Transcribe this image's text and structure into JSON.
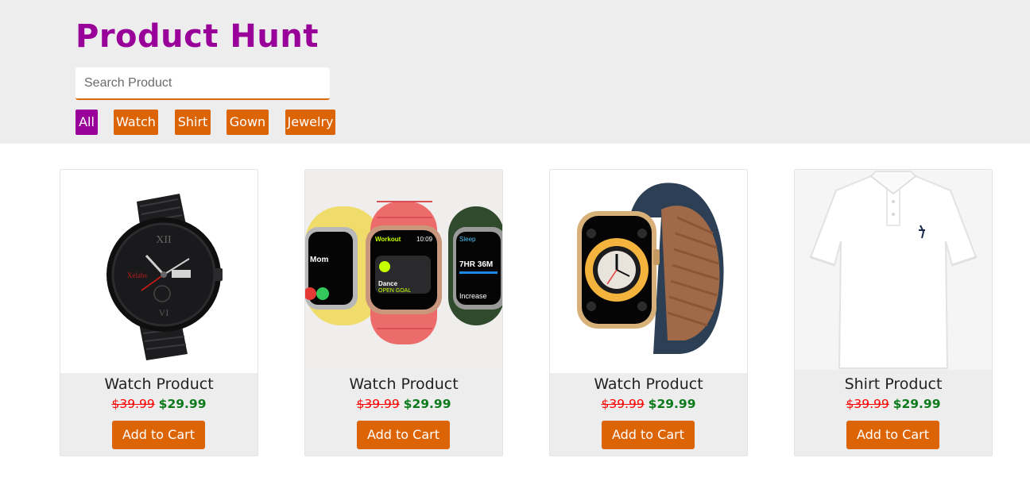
{
  "header": {
    "title": "Product Hunt",
    "search_placeholder": "Search Product",
    "filters": [
      {
        "label": "All",
        "active": true
      },
      {
        "label": "Watch",
        "active": false
      },
      {
        "label": "Shirt",
        "active": false
      },
      {
        "label": "Gown",
        "active": false
      },
      {
        "label": "Jewelry",
        "active": false
      }
    ]
  },
  "colors": {
    "brand": "#990099",
    "accent": "#dd6405",
    "old_price": "#ff0000",
    "new_price": "#0b7a1a",
    "header_bg": "#ededed"
  },
  "products": [
    {
      "name": "Watch Product",
      "old_price": "$39.99",
      "new_price": "$29.99",
      "button": "Add to Cart",
      "image": "black-analog-watch"
    },
    {
      "name": "Watch Product",
      "old_price": "$39.99",
      "new_price": "$29.99",
      "button": "Add to Cart",
      "image": "three-smartwatches"
    },
    {
      "name": "Watch Product",
      "old_price": "$39.99",
      "new_price": "$29.99",
      "button": "Add to Cart",
      "image": "gold-smartwatch-leather-band"
    },
    {
      "name": "Shirt Product",
      "old_price": "$39.99",
      "new_price": "$29.99",
      "button": "Add to Cart",
      "image": "white-polo-shirt"
    }
  ]
}
